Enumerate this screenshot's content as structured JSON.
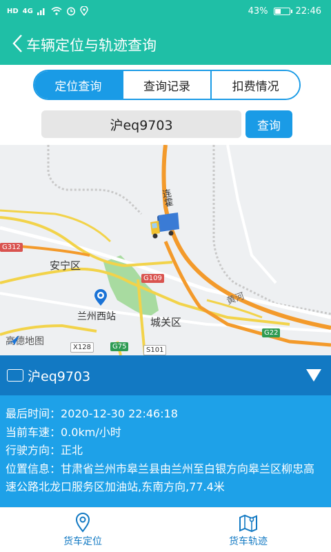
{
  "status": {
    "left_icons": [
      "HD",
      "4G",
      "signal-icon",
      "wifi-icon",
      "alarm-icon",
      "location-icon"
    ],
    "battery": "43%",
    "battery_level": 0.43,
    "time": "22:46"
  },
  "header": {
    "title": "车辆定位与轨迹查询"
  },
  "tabs": [
    {
      "label": "定位查询",
      "active": true
    },
    {
      "label": "查询记录",
      "active": false
    },
    {
      "label": "扣费情况",
      "active": false
    }
  ],
  "search": {
    "value": "沪eq9703",
    "button": "查询"
  },
  "map": {
    "labels": {
      "anning": "安宁区",
      "lanzhou_west": "兰州西站",
      "chengguan": "城关区",
      "lianhuo": "连霍",
      "huanghe": "黄河"
    },
    "roads": [
      "G312",
      "G109",
      "G22",
      "X128",
      "G75",
      "S101"
    ],
    "logo": "高德地图"
  },
  "panel": {
    "plate": "沪eq9703",
    "rows": [
      {
        "label": "最后时间：",
        "value": "2020-12-30 22:46:18"
      },
      {
        "label": "当前车速：",
        "value": "0.0km/小时"
      },
      {
        "label": "行驶方向：",
        "value": "正北"
      },
      {
        "label": "位置信息：",
        "value": "甘肃省兰州市皋兰县由兰州至白银方向皋兰区柳忠高速公路北龙口服务区加油站,东南方向,77.4米"
      }
    ]
  },
  "nav": [
    {
      "label": "货车定位",
      "icon": "location-pin-icon"
    },
    {
      "label": "货车轨迹",
      "icon": "map-route-icon"
    }
  ],
  "colors": {
    "teal": "#1fbfa6",
    "blue": "#1a9be6",
    "panel_dark": "#1279c3",
    "panel_light": "#1ea1e8"
  }
}
